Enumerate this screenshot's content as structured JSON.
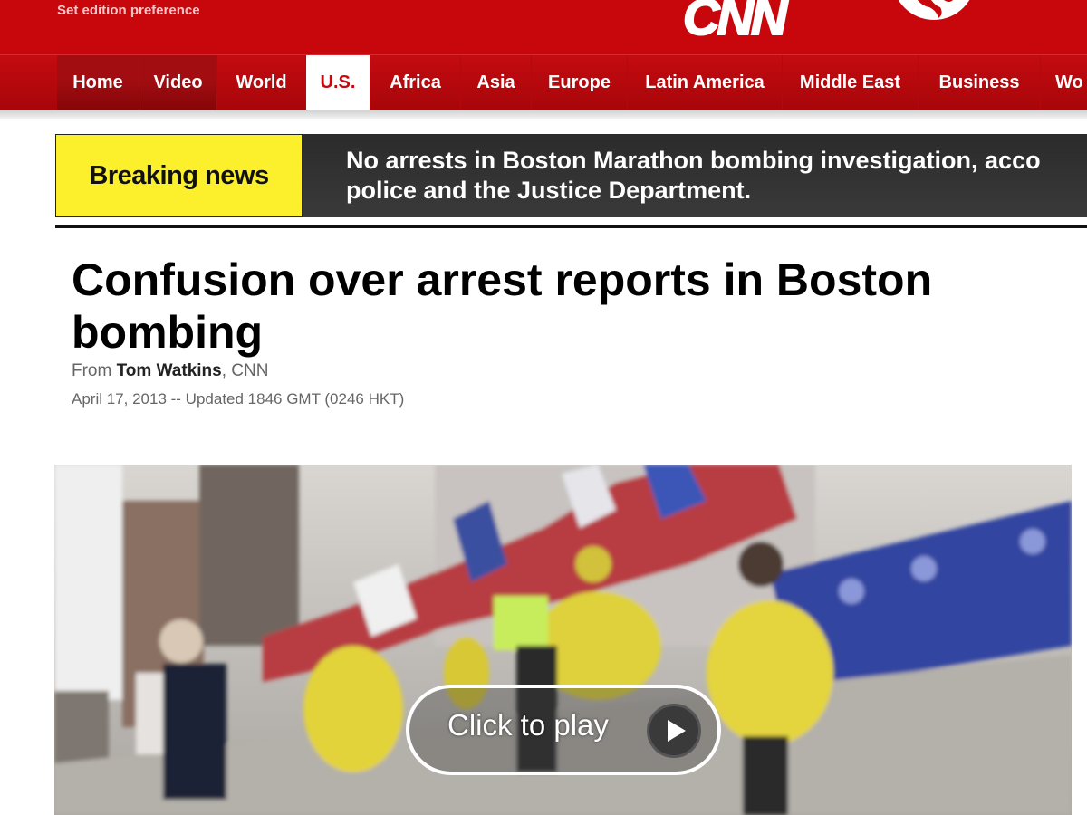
{
  "header": {
    "edition_link": "Set edition preference",
    "logo": "CNN",
    "brand_color": "#c8070d"
  },
  "nav": {
    "items": [
      {
        "label": "Home"
      },
      {
        "label": "Video"
      },
      {
        "label": "World"
      },
      {
        "label": "U.S.",
        "active": true
      },
      {
        "label": "Africa"
      },
      {
        "label": "Asia"
      },
      {
        "label": "Europe"
      },
      {
        "label": "Latin America"
      },
      {
        "label": "Middle East"
      },
      {
        "label": "Business"
      },
      {
        "label": "Wo"
      }
    ]
  },
  "breaking": {
    "label": "Breaking news",
    "line1": "No arrests in Boston Marathon bombing investigation, acco",
    "line2": "police and the Justice Department.",
    "label_color": "#fbf02b"
  },
  "article": {
    "headline_line1": "Confusion over arrest reports in Boston",
    "headline_line2": "bombing",
    "byline_prefix": "From ",
    "author": "Tom Watkins",
    "byline_suffix": ", CNN",
    "dateline": "April 17, 2013 -- Updated 1846 GMT (0246 HKT)"
  },
  "video": {
    "play_label": "Click to play",
    "play_icon": "play-icon"
  }
}
